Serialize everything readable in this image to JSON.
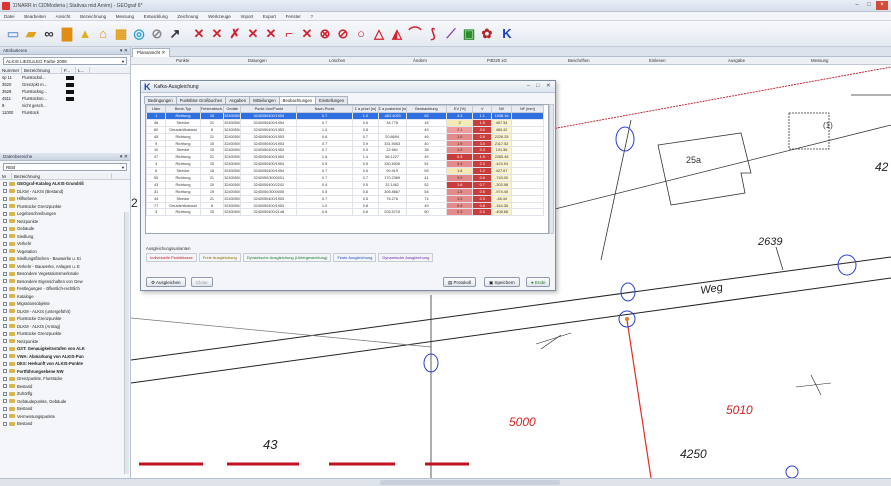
{
  "app": {
    "title": "ΣINARR in CIDModeria | Stativas mid Arnim) - GEOgraf 6*",
    "menu": [
      "Datei",
      "Bearbeiten",
      "Ansicht",
      "Bezeichnung",
      "Messung",
      "Entwicklung",
      "Zeichnung",
      "Werkzeuge",
      "Import",
      "Export",
      "Fenster",
      "?"
    ]
  },
  "toolbar": {
    "icons": [
      "new-file-icon",
      "open-folder-icon",
      "glasses-icon",
      "save-icon",
      "warning-icon",
      "home-icon",
      "grid-icon",
      "target-icon",
      "arrow-icon",
      "cross-icon",
      "scissors-icon",
      "polygon-icon",
      "curve-icon",
      "circle-icon",
      "triangle-icon",
      "spline-icon",
      "paint-icon",
      "database-icon",
      "k-icon"
    ]
  },
  "left": {
    "panel1_title": "Attributieren",
    "layer_combo": "ALKIS LIEGULEG Farbe 2008",
    "layer_headers": [
      "Nummer",
      "Bezeichnung",
      "F...",
      "L..."
    ],
    "layers": [
      {
        "num": "sp 11",
        "label": "Flurstücksl..."
      },
      {
        "num": "3520",
        "label": "Grenzpkt m..."
      },
      {
        "num": "3528",
        "label": "Flurstücksg..."
      },
      {
        "num": "4511",
        "label": "Flurstücksn..."
      },
      {
        "num": "8",
        "label": "nicht gesch..."
      },
      {
        "num": "11000",
        "label": "Flurstück"
      }
    ],
    "panel2_title": "Datenbereiche",
    "tree_combo": "REB",
    "tree_headers": [
      "M",
      "Bezeichnung"
    ],
    "tree": [
      {
        "label": "GEOgraf-Katalog ALKIS-Grundriß",
        "bold": true
      },
      {
        "label": "DLKM - ALKIS (Bestand)",
        "bold": false
      },
      {
        "label": "Hilfsebene",
        "bold": false
      },
      {
        "label": "Flurstücke Grenzpunkte",
        "bold": false
      },
      {
        "label": "Legebeschreibungen",
        "bold": false
      },
      {
        "label": "Netzpunkte",
        "bold": false
      },
      {
        "label": "Gebäude",
        "bold": false
      },
      {
        "label": "Siedlung",
        "bold": false
      },
      {
        "label": "Verkehr",
        "bold": false
      },
      {
        "label": "Vegetation",
        "bold": false
      },
      {
        "label": "Siedlungsflächen - Bauwerke u. Ei",
        "bold": false
      },
      {
        "label": "Verkehr - Bauwerke, Anlagen u. E",
        "bold": false
      },
      {
        "label": "Besondere Vegetationsmerkmale",
        "bold": false
      },
      {
        "label": "Besondere Eigenschaften von Gew",
        "bold": false
      },
      {
        "label": "Festlegungen - öffentlich-rechtlich",
        "bold": false
      },
      {
        "label": "Kataloge",
        "bold": false
      },
      {
        "label": "Migrationsobjekte",
        "bold": false
      },
      {
        "label": "DLKM - ALKIS (untergeführt)",
        "bold": false
      },
      {
        "label": "Flurstücke Grenzpunkte",
        "bold": false
      },
      {
        "label": "DLKM - ALKIS (Antrag)",
        "bold": false
      },
      {
        "label": "Flurstücke Grenzpunkte",
        "bold": false
      },
      {
        "label": "Netzpunkte",
        "bold": false
      },
      {
        "label": "GST: Genauigkeitsstufen von ALK",
        "bold": true
      },
      {
        "label": "VWA: Abmarkung von ALKIS-Pun",
        "bold": true
      },
      {
        "label": "DES: Herkunft von ALKIS-Punkte",
        "bold": true
      },
      {
        "label": "Fortführungsebene NW",
        "bold": true
      },
      {
        "label": "Grenzpunkte, Flurstücke",
        "bold": false
      },
      {
        "label": "Bestand",
        "bold": false
      },
      {
        "label": "Zuhörflg",
        "bold": false
      },
      {
        "label": "Gebäudepunkte, Gebäude",
        "bold": false
      },
      {
        "label": "Bestand",
        "bold": false
      },
      {
        "label": "Vermessungspunkte",
        "bold": false
      },
      {
        "label": "Bestand",
        "bold": false
      }
    ]
  },
  "map_tab": "Planansicht",
  "columns": [
    "Punkte",
    "Datungen",
    "Löschen",
    "Ändern",
    "P3D20 xG",
    "Beschriften",
    "Einlesen",
    "Ausgabe",
    "Messung"
  ],
  "map": {
    "labels": {
      "parcel_25a": "25a",
      "one": "(1)",
      "n2639": "2639",
      "weg": "Weg",
      "n5000": "5000",
      "n5010": "5010",
      "n43": "43",
      "n4250": "4250",
      "n42": "42",
      "n2": "2"
    }
  },
  "dialog": {
    "title": "Kafka-Ausgleichung",
    "tabs": [
      "Bedingungen",
      "Punktliste Großbuchen",
      "Angaben",
      "Mitteilungen",
      "Beobachtungen",
      "Einstellungen"
    ],
    "active_tab": 4,
    "columns": [
      "Lfdnr",
      "Beob-Typ",
      "Fehlerabsch.",
      "Geräte",
      "Punkt-Von/Punkt",
      "Nach-Punkt",
      "Σ a priori [m]",
      "Σ a posteriori [m]",
      "Beobachtung",
      "EV [%]",
      "V",
      "NV",
      "NF [mm]"
    ],
    "rows": [
      [
        "1",
        "Richtung",
        "15",
        "3240050/3000001",
        "3240050400/1954",
        "0.7",
        "1.0",
        "-462.4020",
        "62",
        "4.3",
        "1.1",
        "1038.16",
        ""
      ],
      [
        "46",
        "Strecke",
        "21",
        "3240050/3000003",
        "3240050400/1954",
        "0.7",
        "0.6",
        "34.776",
        "16",
        "2",
        "1.5",
        "407.34",
        ""
      ],
      [
        "80",
        "Gerade/Abstand",
        "8",
        "3240050400/1954",
        "3240050400/1953",
        "1.0",
        "0.8",
        "",
        "49",
        "2.1",
        "3.0",
        "483.42",
        ""
      ],
      [
        "45",
        "Richtung",
        "21",
        "3240050/3000003",
        "3240050400/1953",
        "0.6",
        "0.7",
        "20.8694",
        "46",
        "1.0",
        "2.6",
        "2226.25",
        ""
      ],
      [
        "9",
        "Richtung",
        "15",
        "3240050/3000001",
        "3240050400/1953",
        "0.7",
        "0.9",
        "331.9063",
        "40",
        "1.9",
        "3.0",
        "2117.52",
        ""
      ],
      [
        "10",
        "Strecke",
        "15",
        "3240050/3000001",
        "3240050400/1953",
        "0.7",
        "0.5",
        "22.661",
        "38",
        "1.9",
        "3.3",
        "191.36",
        ""
      ],
      [
        "47",
        "Richtung",
        "21",
        "3240050/3000003",
        "3240050400/1953",
        "1.6",
        "1.4",
        "56.1227",
        "49",
        "0.4",
        "1.9",
        "2285.46",
        ""
      ],
      [
        "4",
        "Richtung",
        "15",
        "3240050/3000001",
        "3240050400/1954",
        "0.5",
        "0.5",
        "330.6926",
        "51",
        "4.4",
        "2.3",
        "-424.94",
        ""
      ],
      [
        "6",
        "Strecke",
        "15",
        "3240050/3000001",
        "3240050400/1954",
        "0.7",
        "0.6",
        "50.919",
        "59",
        "1.8",
        "1.2",
        "427.67",
        ""
      ],
      [
        "50",
        "Richtung",
        "21",
        "3240050/3000005",
        "3240050/3000001",
        "0.7",
        "0.7",
        "170.2369",
        "41",
        "3.0",
        "0.8",
        "-743.00",
        ""
      ],
      [
        "43",
        "Richtung",
        "20",
        "3240050/3000003",
        "3240050400/2242",
        "0.4",
        "0.5",
        "32.1462",
        "52",
        "1.6",
        "0.7",
        "-303.98",
        ""
      ],
      [
        "31",
        "Richtung",
        "19",
        "3240050/3000001",
        "3240050/3000005",
        "0.5",
        "0.6",
        "306.8667",
        "54",
        "1.5",
        "0.5",
        "-974.45",
        ""
      ],
      [
        "44",
        "Strecke",
        "21",
        "3240050/3000005",
        "3240050400/1953",
        "0.7",
        "0.5",
        "76.276",
        "74",
        "1.0",
        "0.3",
        "-46.44",
        ""
      ],
      [
        "77",
        "Gerade/Abstand",
        "8",
        "3240050400/1954",
        "3240050400/1953",
        "1.0",
        "0.8",
        "",
        "49",
        "0.4",
        "0.8",
        "-164.35",
        ""
      ],
      [
        "3",
        "Richtung",
        "15",
        "3240050/3000001",
        "3240050400/2148",
        "0.6",
        "0.6",
        "205.5719",
        "60",
        "0.3",
        "0.3",
        "-408.68",
        ""
      ]
    ],
    "legend_label": "Ausgleichungsvarianten",
    "legend": [
      "Individuelle Punktklasse",
      "Freie Ausgleichung",
      "Dynamische Ausgleichung (Untergewichtung)",
      "Feste Ausgleichung",
      "Dynamische Ausgleichung"
    ],
    "btn_ausgleichen": "Ausgleichen",
    "btn_close": "Close",
    "btn_protokoll": "Protokoll",
    "btn_speichern": "Speichern",
    "btn_ende": "Ende"
  }
}
